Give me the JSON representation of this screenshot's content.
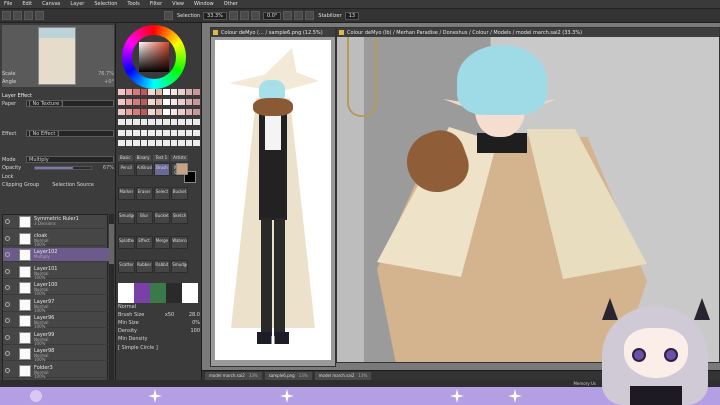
{
  "menu": [
    "File",
    "Edit",
    "Canvas",
    "Layer",
    "Selection",
    "Tools",
    "Filter",
    "View",
    "Window",
    "Other"
  ],
  "toolbar": {
    "selection_label": "Selection",
    "zoom": "33.3%",
    "angle": "0.0°",
    "stabilizer_label": "Stabilizer",
    "stabilizer_value": "13"
  },
  "left_panel": {
    "scale_label": "Scale",
    "scale_value": "76.7%",
    "angle_label": "Angle",
    "angle_value": "+0°",
    "layer_effect": "Layer Effect",
    "paper_label": "Paper",
    "paper_value": "[ No Texture ]",
    "effect_label": "Effect",
    "effect_value": "[ No Effect ]",
    "mode_label": "Mode",
    "mode_value": "Multiply",
    "opacity_label": "Opacity",
    "opacity_value": "67%",
    "opacity_fraction": 0.67,
    "lock_label": "Lock",
    "clipping_group": "Clipping Group",
    "selection_source": "Selection Source"
  },
  "layers": [
    {
      "name": "Symmetric Ruler1",
      "mode": "3 Divisions",
      "opacity": "",
      "selected": false
    },
    {
      "name": "cloak",
      "mode": "Normal",
      "opacity": "100%",
      "selected": false
    },
    {
      "name": "Layer102",
      "mode": "Multiply",
      "opacity": "",
      "selected": true
    },
    {
      "name": "Layer101",
      "mode": "Normal",
      "opacity": "100%",
      "selected": false
    },
    {
      "name": "Layer100",
      "mode": "Normal",
      "opacity": "100%",
      "selected": false
    },
    {
      "name": "Layer97",
      "mode": "Normal",
      "opacity": "100%",
      "selected": false
    },
    {
      "name": "Layer96",
      "mode": "Normal",
      "opacity": "100%",
      "selected": false
    },
    {
      "name": "Layer99",
      "mode": "Normal",
      "opacity": "100%",
      "selected": false
    },
    {
      "name": "Layer98",
      "mode": "Normal",
      "opacity": "100%",
      "selected": false
    },
    {
      "name": "Folder3",
      "mode": "Normal",
      "opacity": "100%",
      "selected": false
    }
  ],
  "tool_tabs": [
    "Basic",
    "Binary",
    "Test 1",
    "Artists"
  ],
  "tools": [
    "Pencil",
    "AirBrush",
    "Brush",
    "Water Color",
    "Marker",
    "Eraser",
    "Select",
    "Bucket",
    "Smudge",
    "Blur",
    "Bucket",
    "Sketch",
    "Splatter",
    "Effect",
    "Merge",
    "Watercolor",
    "Scatter",
    "Rubber",
    "Rabbit",
    "Smudge"
  ],
  "brush": {
    "blend_mode": "Normal",
    "brush_size_label": "Brush Size",
    "brush_size_mult": "x50",
    "brush_size_value": "28.0",
    "min_size_label": "Min Size",
    "min_size_value": "0%",
    "density_label": "Density",
    "density_value": "100",
    "min_density_label": "Min Density",
    "shape_label": "[ Simple Circle ]"
  },
  "windows": {
    "reference_title": "Colour deMyo (… / sample6.png (12.5%)",
    "main_title": "Colour deMyo (lb) / Merhan Paradise / Doneshus / Colour / Models / model march.sai2 (33.3%)"
  },
  "doc_tabs": [
    {
      "name": "model march.sai2",
      "pct": "33%"
    },
    {
      "name": "sample6.png",
      "pct": "13%"
    },
    {
      "name": "model march.sai2",
      "pct": "13%"
    }
  ],
  "status": {
    "memory": "Memory Us"
  },
  "colors": {
    "accent": "#6b5a8a",
    "panel": "#3c3c3c",
    "foreground": "#c8a383",
    "background": "#000000",
    "stream": "#b49ee4"
  }
}
